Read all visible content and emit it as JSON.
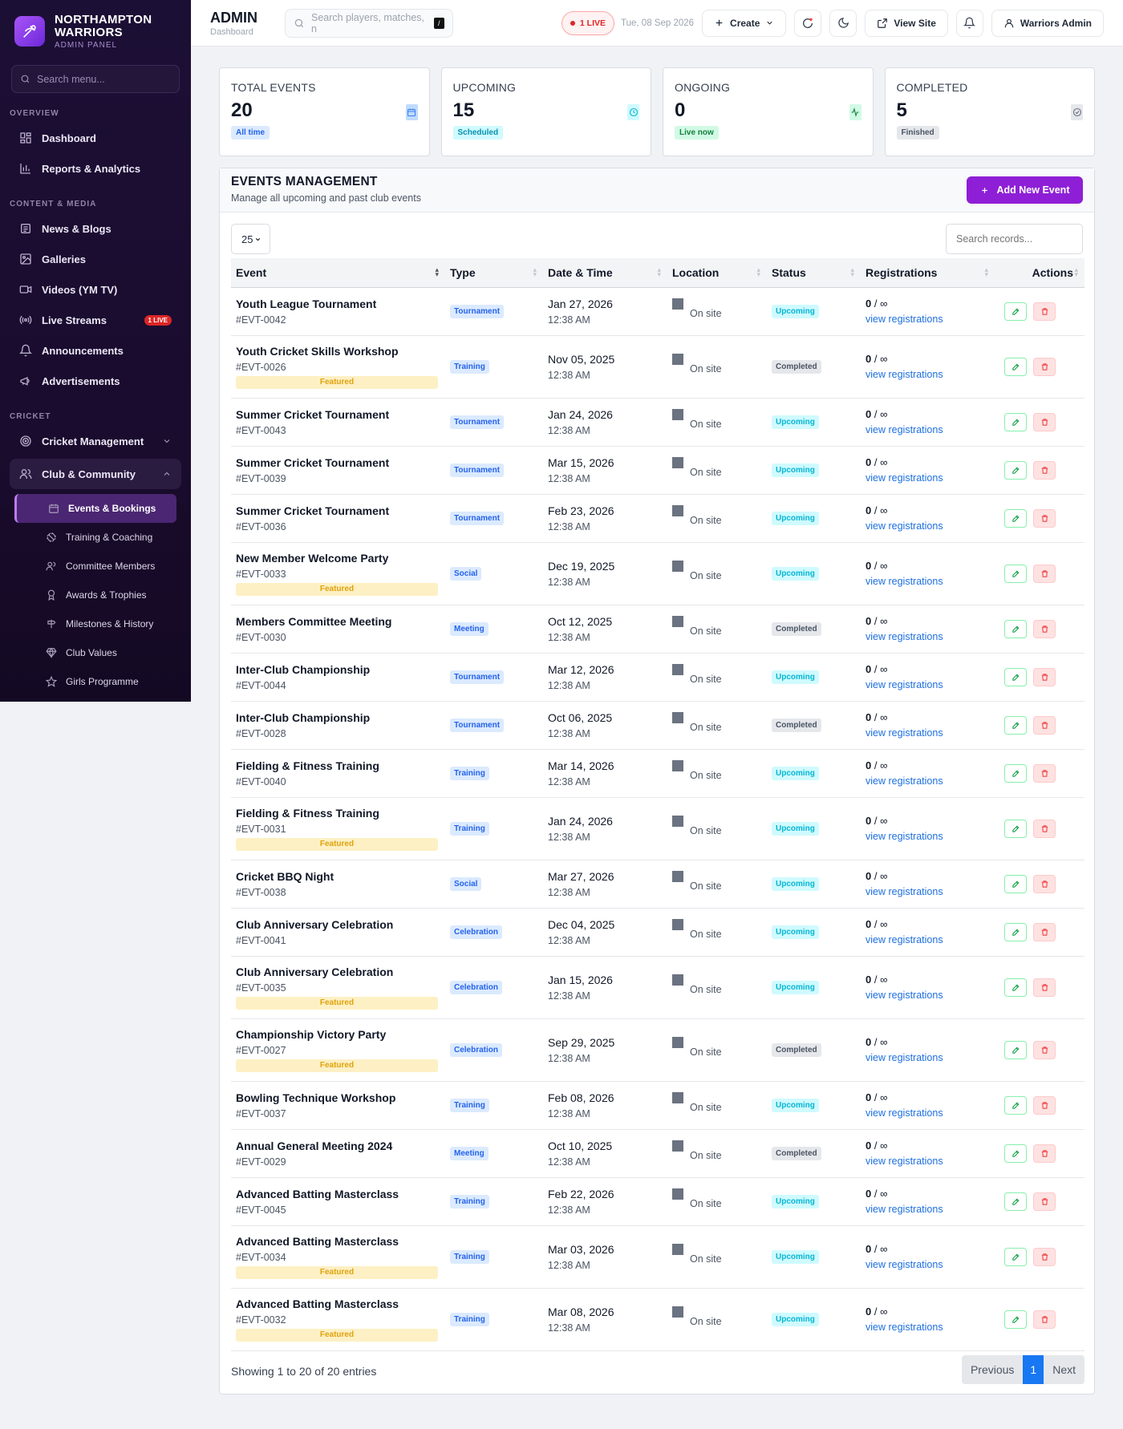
{
  "brand": {
    "line1": "NORTHAMPTON",
    "line2": "WARRIORS",
    "sub": "ADMIN PANEL"
  },
  "sidebar": {
    "search_placeholder": "Search menu...",
    "sections": {
      "overview": "OVERVIEW",
      "content": "CONTENT & MEDIA",
      "cricket": "CRICKET"
    },
    "items": {
      "dashboard": "Dashboard",
      "reports": "Reports & Analytics",
      "news": "News & Blogs",
      "galleries": "Galleries",
      "videos": "Videos (YM TV)",
      "live": "Live Streams",
      "live_badge": "1 LIVE",
      "announcements": "Announcements",
      "ads": "Advertisements",
      "cricket_mgmt": "Cricket Management",
      "club": "Club & Community"
    },
    "sub": {
      "events": "Events & Bookings",
      "training": "Training & Coaching",
      "committee": "Committee Members",
      "awards": "Awards & Trophies",
      "milestones": "Milestones & History",
      "values": "Club Values",
      "girls": "Girls Programme"
    }
  },
  "topbar": {
    "title": "ADMIN",
    "subtitle": "Dashboard",
    "search_placeholder": "Search players, matches, n",
    "kbd": "/",
    "live": "1 LIVE",
    "date": "Tue, 08 Sep 2026",
    "create": "Create",
    "view_site": "View Site",
    "user": "Warriors Admin"
  },
  "stats": [
    {
      "label": "TOTAL EVENTS",
      "value": "20",
      "tag": "All time"
    },
    {
      "label": "UPCOMING",
      "value": "15",
      "tag": "Scheduled"
    },
    {
      "label": "ONGOING",
      "value": "0",
      "tag": "Live now"
    },
    {
      "label": "COMPLETED",
      "value": "5",
      "tag": "Finished"
    }
  ],
  "panel": {
    "title": "EVENTS MANAGEMENT",
    "desc": "Manage all upcoming and past club events",
    "add": "Add New Event",
    "page_len": "25",
    "search_placeholder": "Search records...",
    "columns": [
      "Event",
      "Type",
      "Date & Time",
      "Location",
      "Status",
      "Registrations",
      "Actions"
    ],
    "info": "Showing 1 to 20 of 20 entries",
    "prev": "Previous",
    "page": "1",
    "next": "Next",
    "featured_label": "Featured",
    "location_text": "On site",
    "reg_count": "0",
    "reg_cap": "∞",
    "reg_link": "view registrations"
  },
  "events": [
    {
      "name": "Youth League Tournament",
      "id": "#EVT-0042",
      "featured": false,
      "type": "Tournament",
      "date": "Jan 27, 2026",
      "time": "12:38 AM",
      "status": "Upcoming"
    },
    {
      "name": "Youth Cricket Skills Workshop",
      "id": "#EVT-0026",
      "featured": true,
      "type": "Training",
      "date": "Nov 05, 2025",
      "time": "12:38 AM",
      "status": "Completed"
    },
    {
      "name": "Summer Cricket Tournament",
      "id": "#EVT-0043",
      "featured": false,
      "type": "Tournament",
      "date": "Jan 24, 2026",
      "time": "12:38 AM",
      "status": "Upcoming"
    },
    {
      "name": "Summer Cricket Tournament",
      "id": "#EVT-0039",
      "featured": false,
      "type": "Tournament",
      "date": "Mar 15, 2026",
      "time": "12:38 AM",
      "status": "Upcoming"
    },
    {
      "name": "Summer Cricket Tournament",
      "id": "#EVT-0036",
      "featured": false,
      "type": "Tournament",
      "date": "Feb 23, 2026",
      "time": "12:38 AM",
      "status": "Upcoming"
    },
    {
      "name": "New Member Welcome Party",
      "id": "#EVT-0033",
      "featured": true,
      "type": "Social",
      "date": "Dec 19, 2025",
      "time": "12:38 AM",
      "status": "Upcoming"
    },
    {
      "name": "Members Committee Meeting",
      "id": "#EVT-0030",
      "featured": false,
      "type": "Meeting",
      "date": "Oct 12, 2025",
      "time": "12:38 AM",
      "status": "Completed"
    },
    {
      "name": "Inter-Club Championship",
      "id": "#EVT-0044",
      "featured": false,
      "type": "Tournament",
      "date": "Mar 12, 2026",
      "time": "12:38 AM",
      "status": "Upcoming"
    },
    {
      "name": "Inter-Club Championship",
      "id": "#EVT-0028",
      "featured": false,
      "type": "Tournament",
      "date": "Oct 06, 2025",
      "time": "12:38 AM",
      "status": "Completed"
    },
    {
      "name": "Fielding & Fitness Training",
      "id": "#EVT-0040",
      "featured": false,
      "type": "Training",
      "date": "Mar 14, 2026",
      "time": "12:38 AM",
      "status": "Upcoming"
    },
    {
      "name": "Fielding & Fitness Training",
      "id": "#EVT-0031",
      "featured": true,
      "type": "Training",
      "date": "Jan 24, 2026",
      "time": "12:38 AM",
      "status": "Upcoming"
    },
    {
      "name": "Cricket BBQ Night",
      "id": "#EVT-0038",
      "featured": false,
      "type": "Social",
      "date": "Mar 27, 2026",
      "time": "12:38 AM",
      "status": "Upcoming"
    },
    {
      "name": "Club Anniversary Celebration",
      "id": "#EVT-0041",
      "featured": false,
      "type": "Celebration",
      "date": "Dec 04, 2025",
      "time": "12:38 AM",
      "status": "Upcoming"
    },
    {
      "name": "Club Anniversary Celebration",
      "id": "#EVT-0035",
      "featured": true,
      "type": "Celebration",
      "date": "Jan 15, 2026",
      "time": "12:38 AM",
      "status": "Upcoming"
    },
    {
      "name": "Championship Victory Party",
      "id": "#EVT-0027",
      "featured": true,
      "type": "Celebration",
      "date": "Sep 29, 2025",
      "time": "12:38 AM",
      "status": "Completed"
    },
    {
      "name": "Bowling Technique Workshop",
      "id": "#EVT-0037",
      "featured": false,
      "type": "Training",
      "date": "Feb 08, 2026",
      "time": "12:38 AM",
      "status": "Upcoming"
    },
    {
      "name": "Annual General Meeting 2024",
      "id": "#EVT-0029",
      "featured": false,
      "type": "Meeting",
      "date": "Oct 10, 2025",
      "time": "12:38 AM",
      "status": "Completed"
    },
    {
      "name": "Advanced Batting Masterclass",
      "id": "#EVT-0045",
      "featured": false,
      "type": "Training",
      "date": "Feb 22, 2026",
      "time": "12:38 AM",
      "status": "Upcoming"
    },
    {
      "name": "Advanced Batting Masterclass",
      "id": "#EVT-0034",
      "featured": true,
      "type": "Training",
      "date": "Mar 03, 2026",
      "time": "12:38 AM",
      "status": "Upcoming"
    },
    {
      "name": "Advanced Batting Masterclass",
      "id": "#EVT-0032",
      "featured": true,
      "type": "Training",
      "date": "Mar 08, 2026",
      "time": "12:38 AM",
      "status": "Upcoming"
    }
  ],
  "colors": {
    "accent": "#8e1fd6",
    "sidebar_bg": "#1c0f35",
    "upcoming": "#06b6d4",
    "link": "#1d6fe0",
    "live": "#dc2626"
  }
}
